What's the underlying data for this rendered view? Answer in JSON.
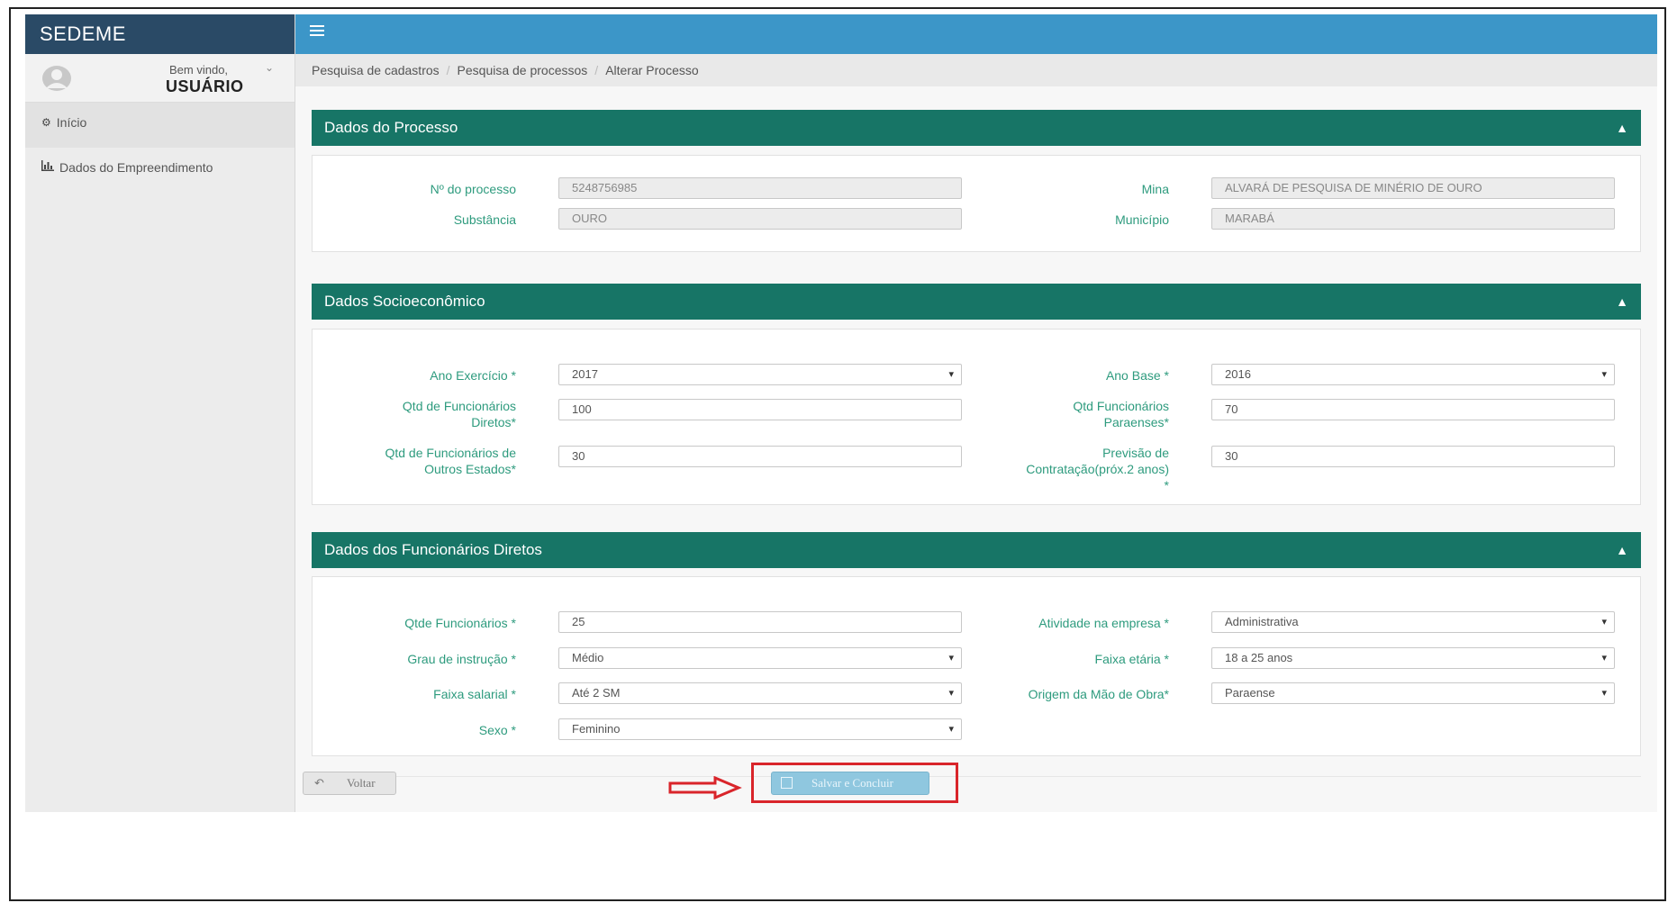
{
  "app": {
    "brand": "SEDEME"
  },
  "user": {
    "welcome": "Bem vindo,",
    "name": "USUÁRIO"
  },
  "sidebar": {
    "items": [
      {
        "label": "Início",
        "icon": "dashboard-icon"
      },
      {
        "label": "Dados do Empreendimento",
        "icon": "bar-chart-icon"
      }
    ]
  },
  "breadcrumb": [
    "Pesquisa de cadastros",
    "Pesquisa de processos",
    "Alterar Processo"
  ],
  "panels": {
    "processo": {
      "title": "Dados do Processo",
      "num_label": "Nº do processo",
      "num_value": "5248756985",
      "mina_label": "Mina",
      "mina_value": "ALVARÁ DE PESQUISA DE MINÉRIO DE OURO",
      "substancia_label": "Substância",
      "substancia_value": "OURO",
      "municipio_label": "Município",
      "municipio_value": "MARABÁ"
    },
    "socio": {
      "title": "Dados Socioeconômico",
      "ano_exercicio_label": "Ano Exercício *",
      "ano_exercicio_value": "2017",
      "ano_base_label": "Ano Base *",
      "ano_base_value": "2016",
      "qtd_diretos_label_1": "Qtd de Funcionários",
      "qtd_diretos_label_2": "Diretos*",
      "qtd_diretos_value": "100",
      "qtd_paraenses_label_1": "Qtd Funcionários",
      "qtd_paraenses_label_2": "Paraenses*",
      "qtd_paraenses_value": "70",
      "qtd_outros_label_1": "Qtd de Funcionários de",
      "qtd_outros_label_2": "Outros Estados*",
      "qtd_outros_value": "30",
      "previsao_label_1": "Previsão de",
      "previsao_label_2": "Contratação(próx.2 anos)",
      "previsao_label_3": "*",
      "previsao_value": "30"
    },
    "funcionarios": {
      "title": "Dados dos Funcionários Diretos",
      "qtde_label": "Qtde Funcionários *",
      "qtde_value": "25",
      "atividade_label": "Atividade na empresa *",
      "atividade_value": "Administrativa",
      "grau_label": "Grau de instrução *",
      "grau_value": "Médio",
      "faixa_etaria_label": "Faixa etária *",
      "faixa_etaria_value": "18 a 25 anos",
      "faixa_salarial_label": "Faixa salarial *",
      "faixa_salarial_value": "Até 2 SM",
      "origem_label": "Origem da Mão de Obra*",
      "origem_value": "Paraense",
      "sexo_label": "Sexo *",
      "sexo_value": "Feminino"
    }
  },
  "actions": {
    "back_label": "Voltar",
    "save_label": "Salvar e Concluir"
  },
  "colors": {
    "brand_bar": "#2a4a66",
    "topbar": "#3c96c8",
    "panel_header": "#177566",
    "label": "#2e9b7e",
    "highlight": "#d9252b"
  }
}
